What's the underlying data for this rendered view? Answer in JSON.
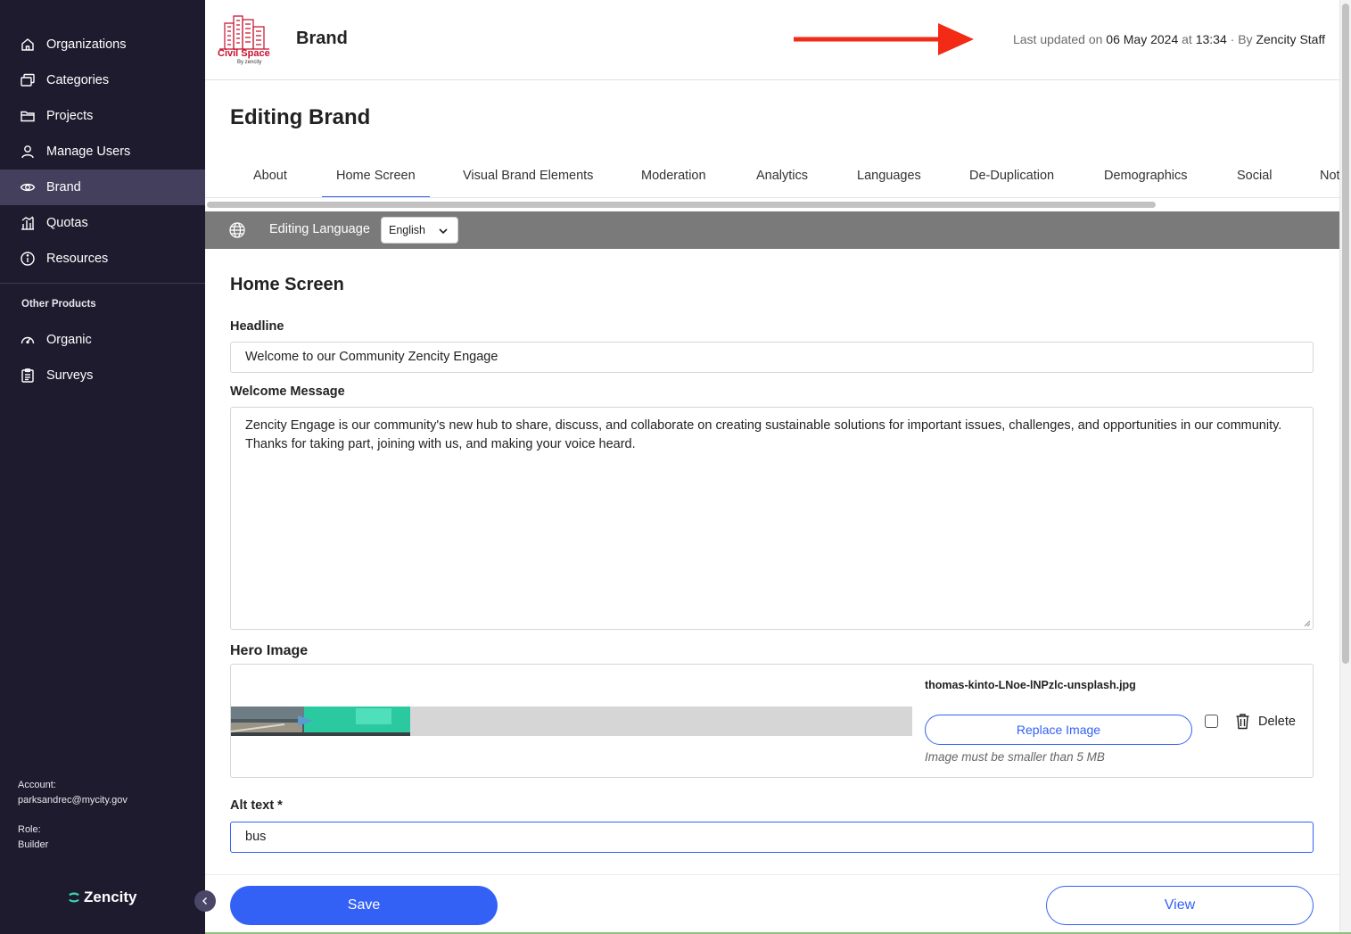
{
  "sidebar": {
    "items": [
      {
        "label": "Organizations",
        "icon": "home-icon"
      },
      {
        "label": "Categories",
        "icon": "categories-icon"
      },
      {
        "label": "Projects",
        "icon": "folder-icon"
      },
      {
        "label": "Manage Users",
        "icon": "user-icon"
      },
      {
        "label": "Brand",
        "icon": "eye-icon",
        "active": true
      },
      {
        "label": "Quotas",
        "icon": "bar-chart-icon"
      },
      {
        "label": "Resources",
        "icon": "info-icon"
      }
    ],
    "other_products_label": "Other Products",
    "other_products": [
      {
        "label": "Organic",
        "icon": "gauge-icon"
      },
      {
        "label": "Surveys",
        "icon": "clipboard-icon"
      }
    ],
    "account_label": "Account:",
    "account_value": "parksandrec@mycity.gov",
    "role_label": "Role:",
    "role_value": "Builder",
    "logo_text": "Zencity"
  },
  "header": {
    "logo_text_line1": "Civil Space",
    "logo_text_line2": "By zencity",
    "title": "Brand",
    "last_updated_prefix": "Last updated on",
    "last_updated_date": "06 May 2024",
    "last_updated_at": "at",
    "last_updated_time": "13:34",
    "last_updated_by": "· By",
    "last_updated_user": "Zencity Staff"
  },
  "page": {
    "title": "Editing Brand",
    "tabs": [
      "About",
      "Home Screen",
      "Visual Brand Elements",
      "Moderation",
      "Analytics",
      "Languages",
      "De-Duplication",
      "Demographics",
      "Social",
      "Not"
    ],
    "active_tab": "Home Screen"
  },
  "language_bar": {
    "label": "Editing Language",
    "selected": "English"
  },
  "form": {
    "section_title": "Home Screen",
    "headline_label": "Headline",
    "headline_value": "Welcome to our Community Zencity Engage",
    "welcome_label": "Welcome Message",
    "welcome_value": "Zencity Engage is our community's new hub to share, discuss, and collaborate on creating sustainable solutions for important issues, challenges, and opportunities in our community. Thanks for taking part, joining with us, and making your voice heard.",
    "hero_label": "Hero Image",
    "hero_file_name": "thomas-kinto-LNoe-lNPzlc-unsplash.jpg",
    "replace_label": "Replace Image",
    "size_note": "Image must be smaller than 5 MB",
    "delete_label": "Delete",
    "alt_label": "Alt text *",
    "alt_value": "bus"
  },
  "footer": {
    "save_label": "Save",
    "view_label": "View"
  },
  "colors": {
    "sidebar_bg": "#1e1b2e",
    "active_nav": "#433f5c",
    "accent": "#3361f5",
    "lang_bar": "#7a7a7a",
    "arrow": "#f22a16"
  }
}
